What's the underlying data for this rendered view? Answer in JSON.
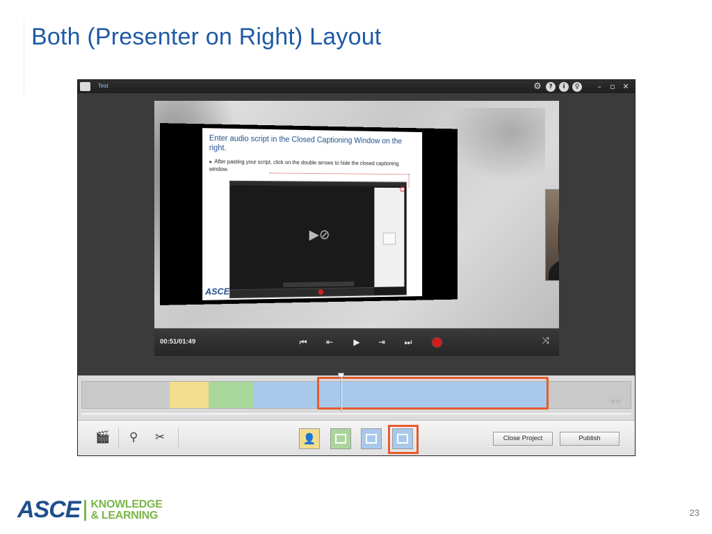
{
  "slide": {
    "title": "Both (Presenter on Right) Layout",
    "page_number": "23"
  },
  "app": {
    "window_title": "Test",
    "titlebar_icons": [
      "gear-icon",
      "help-icon",
      "info-icon",
      "bulb-icon",
      "minimize-icon",
      "maximize-icon",
      "close-icon"
    ]
  },
  "stage": {
    "slide_heading": "Enter audio script in the Closed Captioning Window on the right.",
    "slide_bullet": "After pasting your script, click on the double arrows to hide the closed captioning window.",
    "slide_logo": "ASCE"
  },
  "player": {
    "time": "00:51/01:49"
  },
  "toolbar": {
    "close_project_label": "Close Project",
    "publish_label": "Publish"
  },
  "colors": {
    "accent_highlight": "#e85a2a",
    "title_blue": "#1f5aa6",
    "segment_yellow": "#f2dd8e",
    "segment_green": "#a9d69a",
    "segment_blue": "#a8c9ec"
  },
  "footer": {
    "brand": "ASCE",
    "tagline_line1": "KNOWLEDGE",
    "tagline_line2": "& LEARNING"
  }
}
